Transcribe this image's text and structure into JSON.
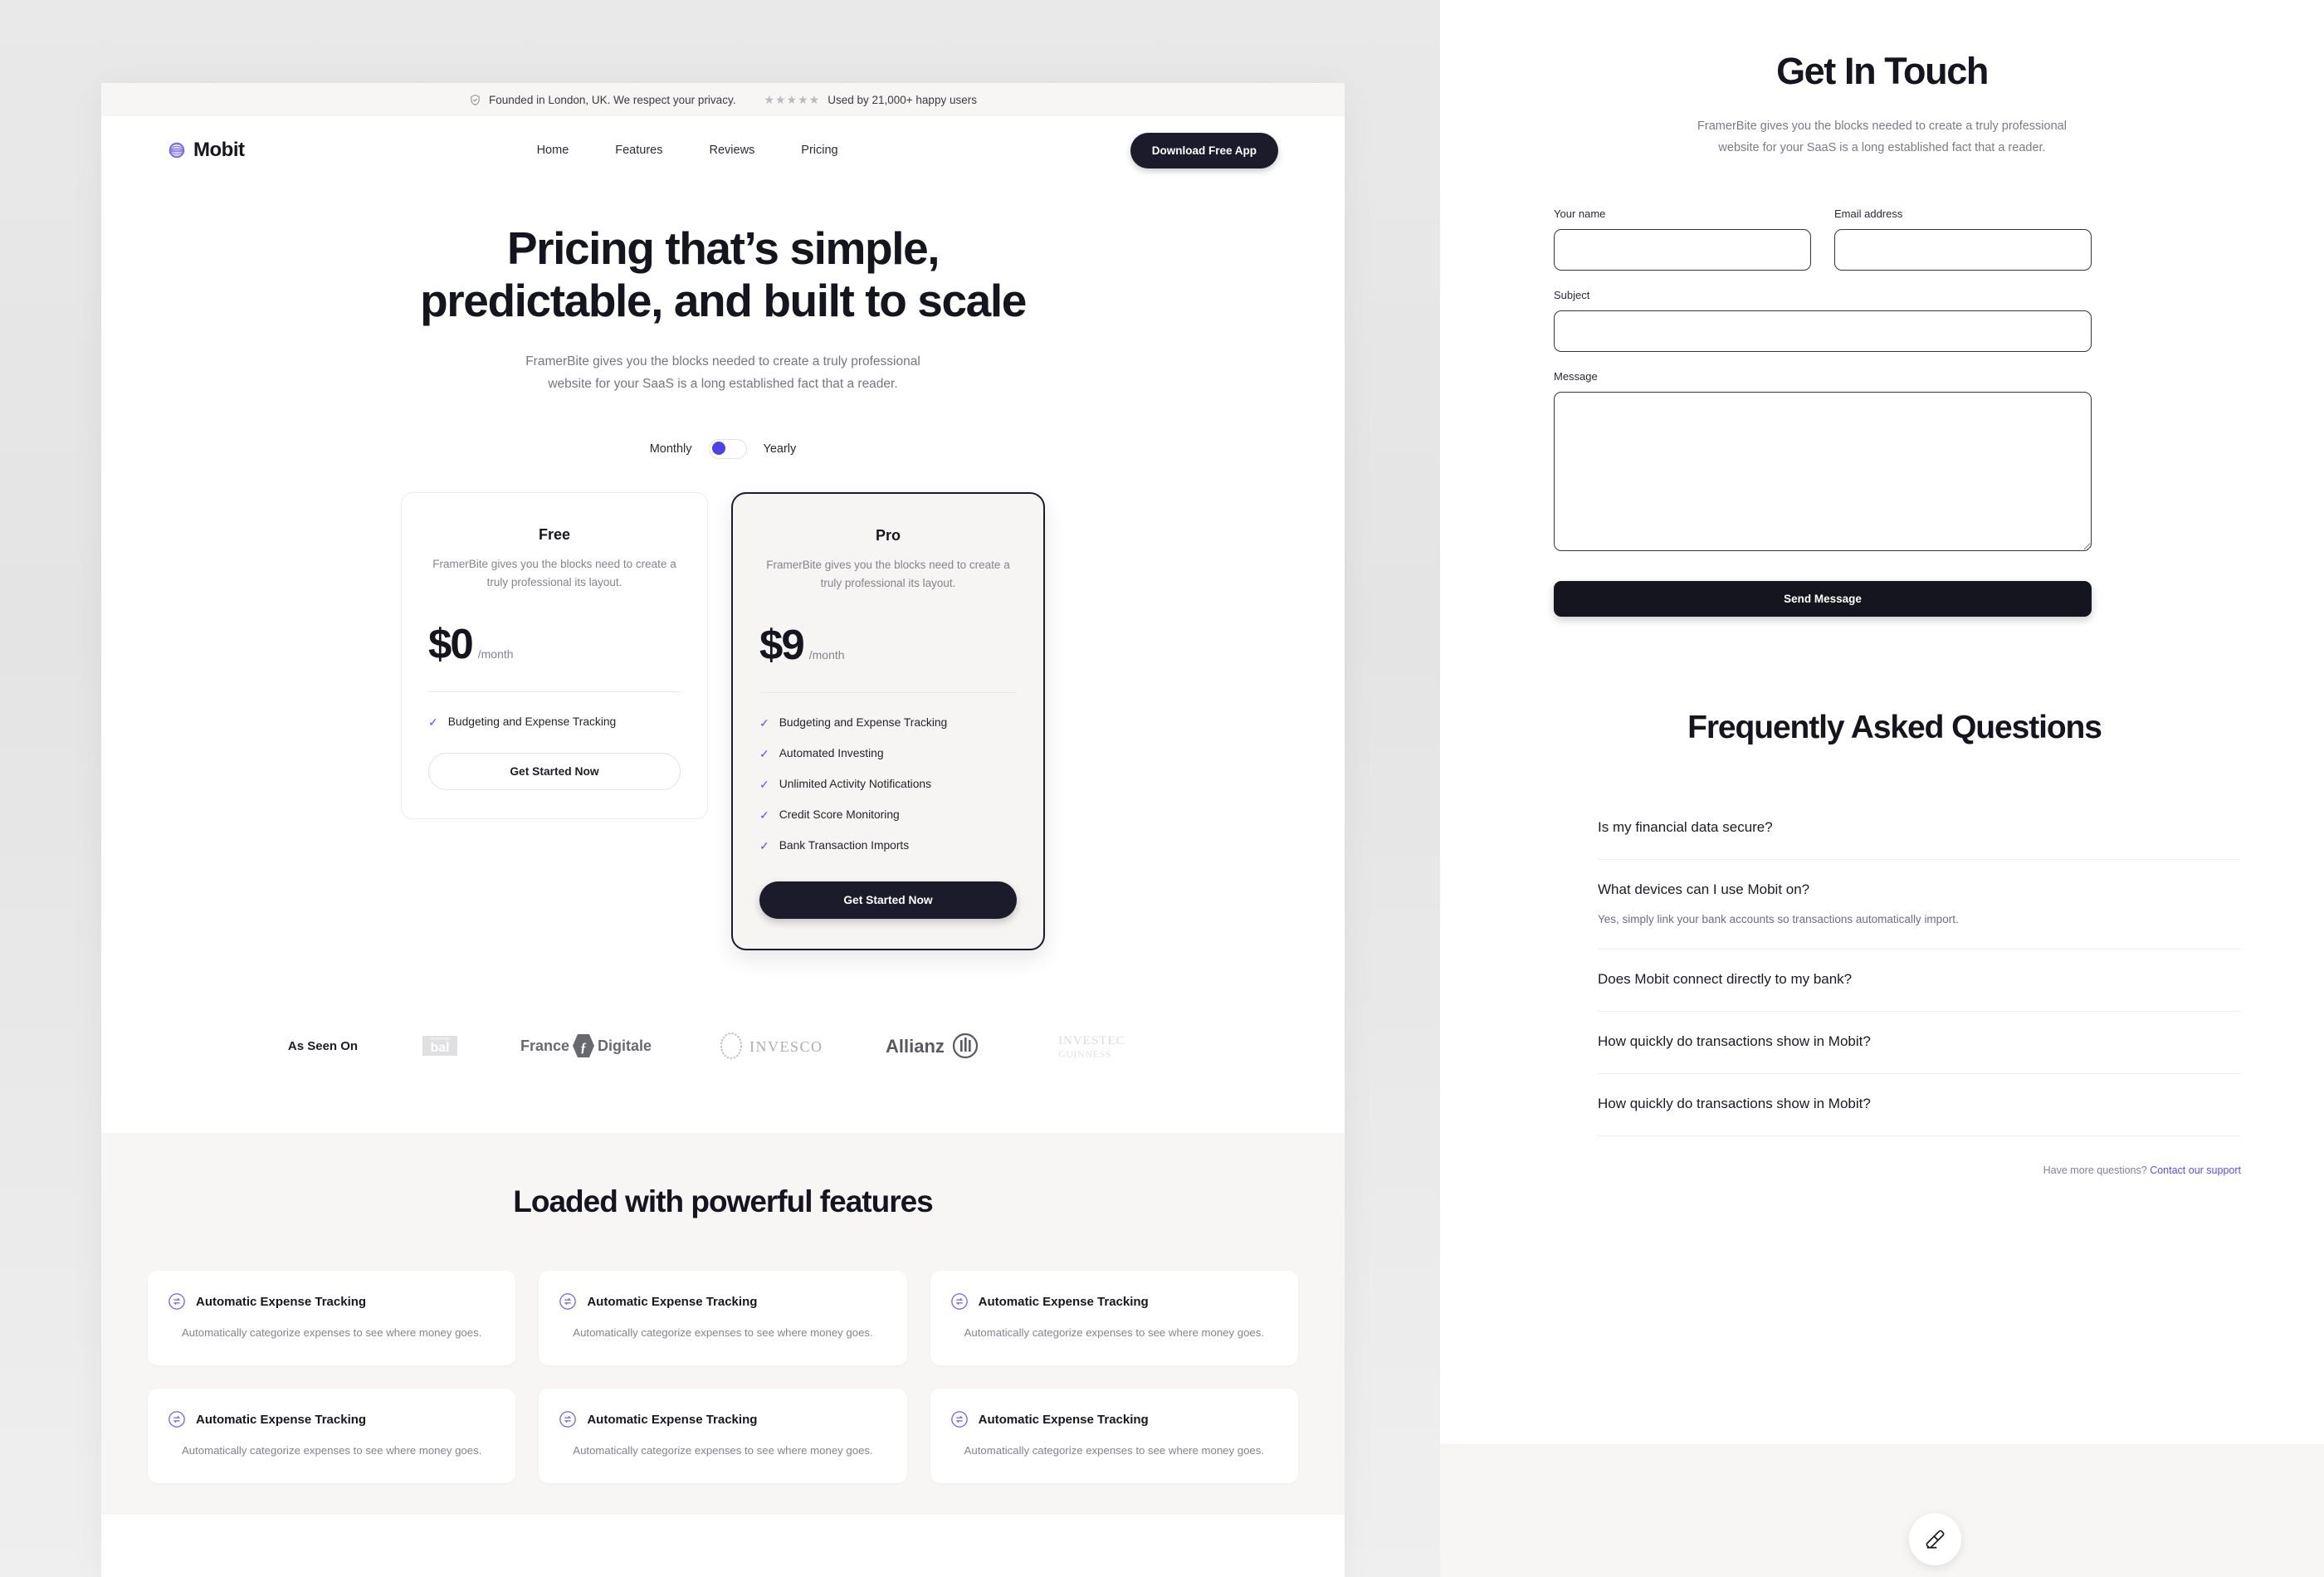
{
  "colors": {
    "accent": "#5b4ef0",
    "dark": "#1b1b2b",
    "page_bg": "#e6e6e6",
    "panel_bg": "#ffffff",
    "band_bg": "#f7f6f4",
    "muted_text": "#84848d"
  },
  "left": {
    "topbar": {
      "privacy_text": "Founded in London, UK. We respect your privacy.",
      "stars": "★★★★★",
      "users_text": "Used by 21,000+ happy users",
      "shield_icon": "shield-check-icon"
    },
    "nav": {
      "brand": "Mobit",
      "brand_icon": "striped-sphere-logo-icon",
      "links": [
        "Home",
        "Features",
        "Reviews",
        "Pricing"
      ],
      "cta": "Download Free App"
    },
    "hero": {
      "title_line1": "Pricing that’s simple,",
      "title_line2": "predictable, and built to scale",
      "subtitle_line1": "FramerBite gives you the blocks needed to create a truly professional",
      "subtitle_line2": "website for your SaaS is a long established fact that a reader."
    },
    "billing_toggle": {
      "monthly_label": "Monthly",
      "yearly_label": "Yearly",
      "selected": "Monthly"
    },
    "plans": [
      {
        "name": "Free",
        "description": "FramerBite gives you the blocks need to create a truly professional its layout.",
        "amount": "$0",
        "period": "/month",
        "features": [
          "Budgeting and Expense Tracking"
        ],
        "cta": "Get Started Now"
      },
      {
        "name": "Pro",
        "description": "FramerBite gives you the blocks need to create a truly professional its layout.",
        "amount": "$9",
        "period": "/month",
        "features": [
          "Budgeting and Expense Tracking",
          "Automated Investing",
          "Unlimited Activity Notifications",
          "Credit Score Monitoring",
          "Bank Transaction Imports"
        ],
        "cta": "Get Started Now"
      }
    ],
    "as_seen_on": {
      "label": "As Seen On",
      "logos": [
        "Global",
        "France Digitale",
        "INVESCO",
        "Allianz",
        "INVESTEC Guinness"
      ]
    },
    "features_section": {
      "heading": "Loaded with powerful features",
      "cards": [
        {
          "title": "Automatic Expense Tracking",
          "body": "Automatically categorize expenses to see where money goes.",
          "icon": "sync-circle-icon"
        },
        {
          "title": "Automatic Expense Tracking",
          "body": "Automatically categorize expenses to see where money goes.",
          "icon": "sync-circle-icon"
        },
        {
          "title": "Automatic Expense Tracking",
          "body": "Automatically categorize expenses to see where money goes.",
          "icon": "sync-circle-icon"
        },
        {
          "title": "Automatic Expense Tracking",
          "body": "Automatically categorize expenses to see where money goes.",
          "icon": "sync-circle-icon"
        },
        {
          "title": "Automatic Expense Tracking",
          "body": "Automatically categorize expenses to see where money goes.",
          "icon": "sync-circle-icon"
        },
        {
          "title": "Automatic Expense Tracking",
          "body": "Automatically categorize expenses to see where money goes.",
          "icon": "sync-circle-icon"
        }
      ]
    }
  },
  "right": {
    "contact": {
      "heading": "Get In Touch",
      "subtitle_line1": "FramerBite gives you the blocks needed to create a truly professional",
      "subtitle_line2": "website for your SaaS is a long established fact that a reader.",
      "fields": {
        "name_label": "Your name",
        "name_value": "",
        "email_label": "Email address",
        "email_value": "",
        "subject_label": "Subject",
        "subject_value": "",
        "message_label": "Message",
        "message_value": ""
      },
      "submit": "Send Message"
    },
    "faq": {
      "heading": "Frequently Asked Questions",
      "items": [
        {
          "question": "Is my financial data secure?",
          "answer": ""
        },
        {
          "question": "What devices can I use Mobit on?",
          "answer": "Yes, simply link your bank accounts so transactions automatically import."
        },
        {
          "question": "Does Mobit connect directly to my bank?",
          "answer": ""
        },
        {
          "question": "How quickly do transactions show in Mobit?",
          "answer": ""
        },
        {
          "question": "How quickly do transactions show in Mobit?",
          "answer": ""
        }
      ],
      "footer_text": "Have more questions?",
      "footer_link": "Contact our support"
    },
    "fab": {
      "icon": "eraser-icon"
    }
  }
}
